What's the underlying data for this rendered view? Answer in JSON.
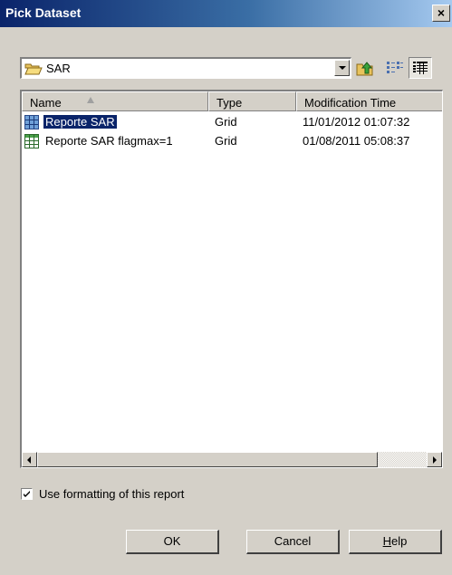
{
  "window": {
    "title": "Pick Dataset",
    "close_glyph": "×"
  },
  "location": {
    "current": "SAR",
    "icon": "folder-open-icon"
  },
  "toolbar": {
    "up_icon": "up-one-level-icon",
    "list_icon": "list-view-icon",
    "details_icon": "details-view-icon"
  },
  "list": {
    "columns": [
      "Name",
      "Type",
      "Modification Time"
    ],
    "sort_column": "Name",
    "rows": [
      {
        "name": "Reporte SAR",
        "type": "Grid",
        "modified": "11/01/2012 01:07:32",
        "icon": "grid-dataset-icon",
        "selected": true
      },
      {
        "name": "Reporte SAR flagmax=1",
        "type": "Grid",
        "modified": "01/08/2011 05:08:37",
        "icon": "grid-dataset-icon",
        "selected": false
      }
    ]
  },
  "options": {
    "use_formatting_label": "Use formatting of this report",
    "use_formatting_checked": true
  },
  "buttons": {
    "ok": "OK",
    "cancel": "Cancel",
    "help_first": "H",
    "help_rest": "elp"
  },
  "colors": {
    "title_bar": "#0a246a",
    "selection": "#0a246a",
    "dialog_bg": "#d4d0c8"
  }
}
